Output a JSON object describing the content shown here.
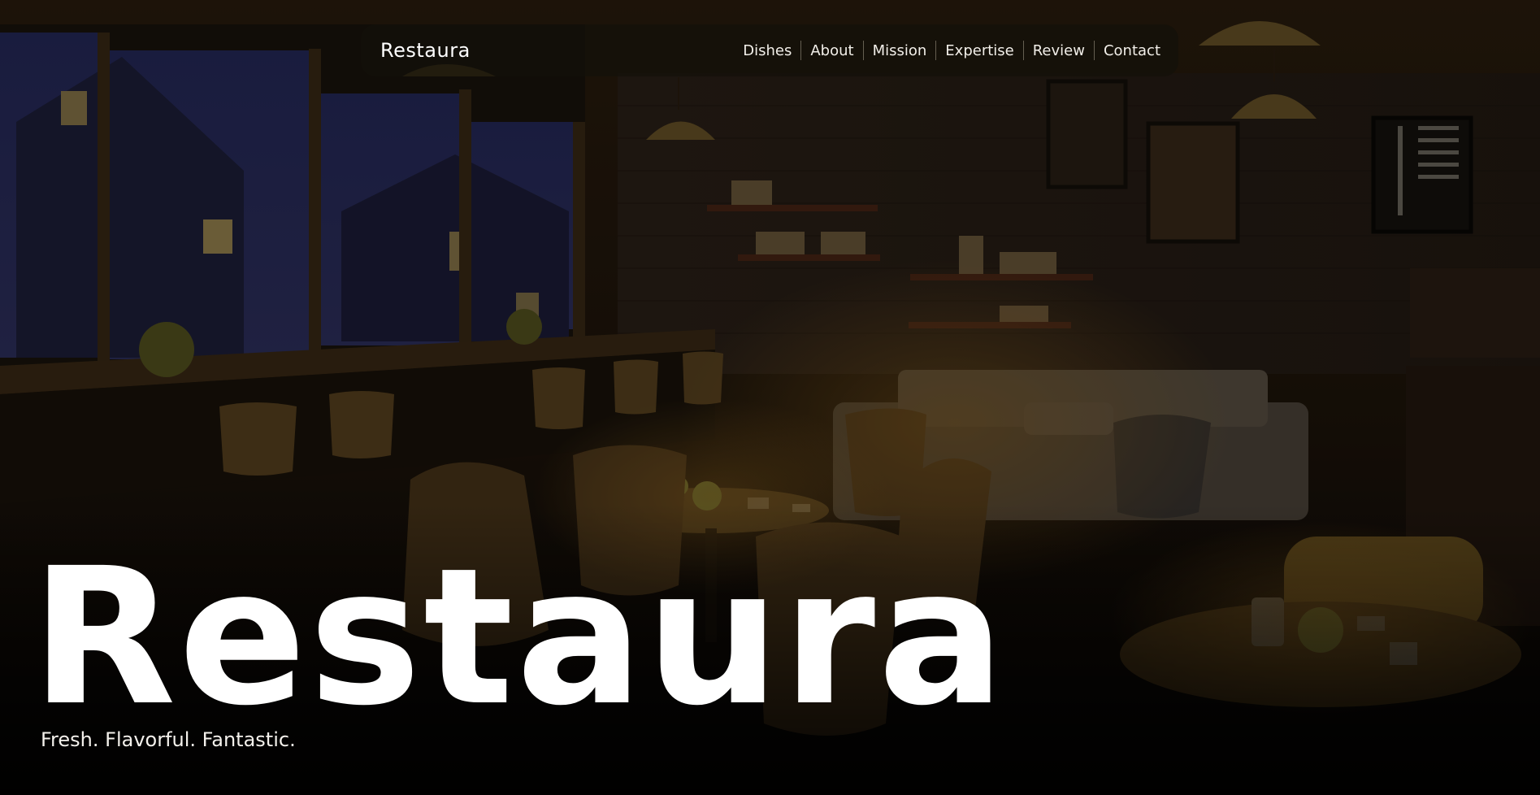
{
  "nav": {
    "brand": "Restaura",
    "links": [
      {
        "label": "Dishes"
      },
      {
        "label": "About"
      },
      {
        "label": "Mission"
      },
      {
        "label": "Expertise"
      },
      {
        "label": "Review"
      },
      {
        "label": "Contact"
      }
    ]
  },
  "hero": {
    "title": "Restaura",
    "tagline": "Fresh. Flavorful. Fantastic."
  },
  "colors": {
    "navbar_bg": "#14100a",
    "text": "#ffffff",
    "scene_warm": "#6a4a1c",
    "window_night": "#2a2c5a"
  },
  "icons": {
    "hero_image": "restaurant-interior-image"
  }
}
